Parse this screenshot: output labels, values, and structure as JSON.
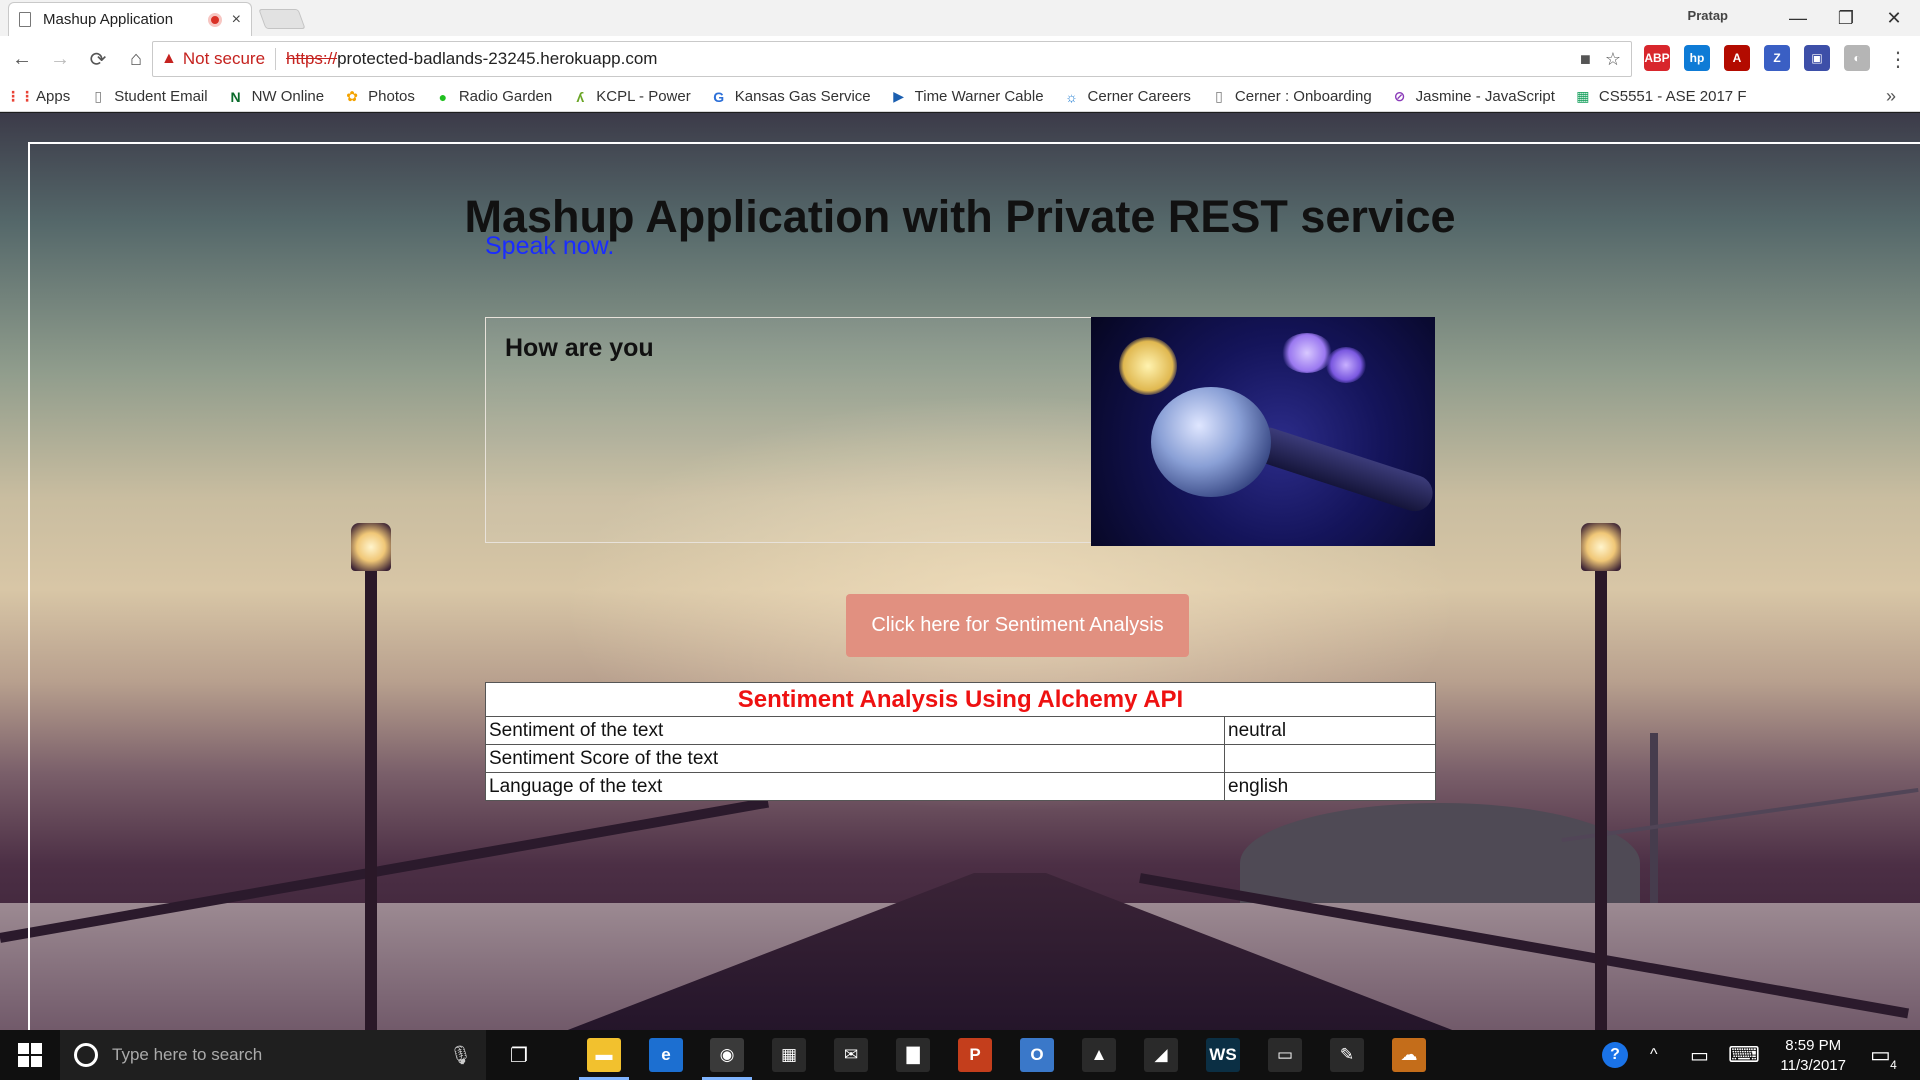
{
  "browser": {
    "tab_title": "Mashup Application",
    "tab_close": "×",
    "profile_name": "Pratap",
    "window": {
      "minimize": "—",
      "restore": "❐",
      "close": "✕"
    },
    "nav": {
      "back": "←",
      "forward": "→",
      "reload": "⟳",
      "home": "⌂"
    },
    "address": {
      "warning_icon": "▲",
      "security_label": "Not secure",
      "scheme": "https://",
      "host": "protected-badlands-23245.herokuapp.com"
    },
    "omnibox_icons": {
      "camera": "■",
      "star": "☆"
    },
    "extensions": [
      {
        "name": "adblock-plus",
        "label": "ABP",
        "color": "#d8262c"
      },
      {
        "name": "hp",
        "label": "hp",
        "color": "#0e7bd6"
      },
      {
        "name": "acrobat",
        "label": "A",
        "color": "#b30b00"
      },
      {
        "name": "zotero",
        "label": "Z",
        "color": "#3a5fc4"
      },
      {
        "name": "extension",
        "label": "▣",
        "color": "#3d4fa8"
      },
      {
        "name": "extension-grey",
        "label": "◐",
        "color": "#b5b5b5"
      }
    ],
    "menu": "⋮",
    "bookmarks": [
      {
        "label": "Apps",
        "icon": "apps-icon"
      },
      {
        "label": "Student Email",
        "icon": "page-icon"
      },
      {
        "label": "NW Online",
        "icon": "nw-icon"
      },
      {
        "label": "Photos",
        "icon": "photos-icon"
      },
      {
        "label": "Radio Garden",
        "icon": "radio-icon"
      },
      {
        "label": "KCPL - Power",
        "icon": "kcpl-icon"
      },
      {
        "label": "Kansas Gas Service",
        "icon": "google-icon"
      },
      {
        "label": "Time Warner Cable",
        "icon": "play-icon"
      },
      {
        "label": "Cerner Careers",
        "icon": "cerner-icon"
      },
      {
        "label": "Cerner : Onboarding",
        "icon": "page-icon"
      },
      {
        "label": "Jasmine - JavaScript",
        "icon": "jasmine-icon"
      },
      {
        "label": "CS5551 - ASE 2017 F",
        "icon": "sheets-icon"
      }
    ],
    "bookmarks_more": "»"
  },
  "page": {
    "heading": "Mashup Application with Private REST service",
    "speak_prompt": "Speak now.",
    "transcript": "How are you",
    "sentiment_button": "Click here for Sentiment Analysis",
    "table": {
      "caption": "Sentiment Analysis Using Alchemy API",
      "rows": [
        {
          "label": "Sentiment of the text",
          "value": "neutral"
        },
        {
          "label": "Sentiment Score of the text",
          "value": ""
        },
        {
          "label": "Language of the text",
          "value": "english"
        }
      ]
    }
  },
  "taskbar": {
    "search_placeholder": "Type here to search",
    "time": "8:59 PM",
    "date": "11/3/2017",
    "notifications": "4",
    "tray": {
      "help": "?",
      "chevron": "^",
      "battery": "▭",
      "keyboard": "⌨"
    },
    "apps": [
      {
        "name": "file-explorer",
        "glyph": "▬",
        "color": "#f2c12e"
      },
      {
        "name": "edge",
        "glyph": "e",
        "color": "#1c6fd1"
      },
      {
        "name": "chrome",
        "glyph": "◉",
        "color": "#3a3a3a"
      },
      {
        "name": "store",
        "glyph": "▦",
        "color": "#2a2a2a"
      },
      {
        "name": "mail",
        "glyph": "✉",
        "color": "#2a2a2a"
      },
      {
        "name": "sticky-notes",
        "glyph": "▇",
        "color": "#2a2a2a"
      },
      {
        "name": "powerpoint",
        "glyph": "P",
        "color": "#c43e1c"
      },
      {
        "name": "outlook",
        "glyph": "O",
        "color": "#3a78c9"
      },
      {
        "name": "excel-app",
        "glyph": "▲",
        "color": "#2a2a2a"
      },
      {
        "name": "notes",
        "glyph": "◢",
        "color": "#2a2a2a"
      },
      {
        "name": "webstorm",
        "glyph": "WS",
        "color": "#0b2f44"
      },
      {
        "name": "command-prompt",
        "glyph": "▭",
        "color": "#2a2a2a"
      },
      {
        "name": "paint",
        "glyph": "✎",
        "color": "#2a2a2a"
      },
      {
        "name": "onedrive",
        "glyph": "☁",
        "color": "#c46d1a"
      }
    ]
  }
}
